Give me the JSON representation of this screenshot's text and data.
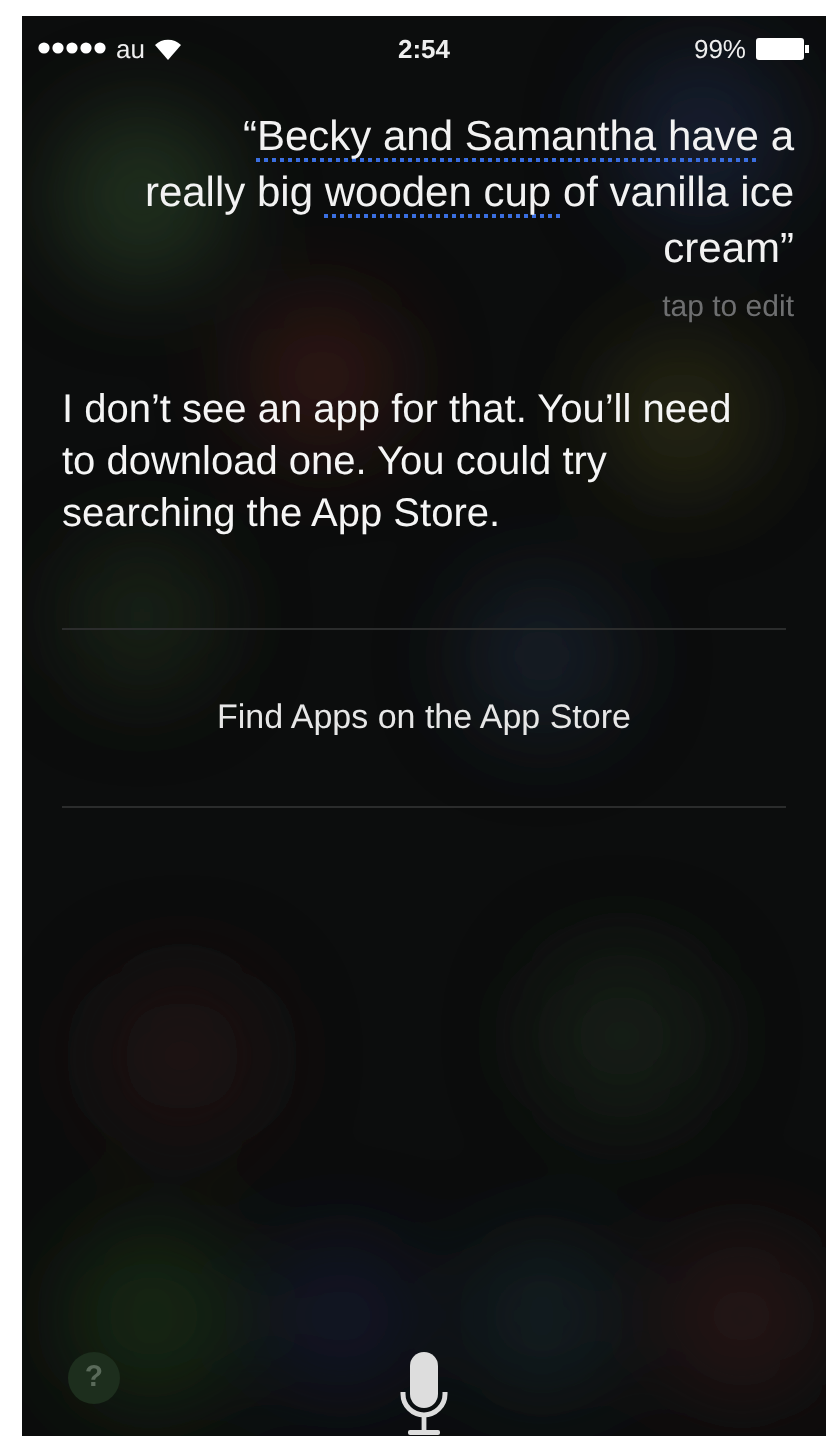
{
  "status_bar": {
    "carrier": "au",
    "time": "2:54",
    "battery": "99%"
  },
  "request": {
    "segments": [
      {
        "text": "“",
        "underlined": false
      },
      {
        "text": "Becky and Samantha have",
        "underlined": true
      },
      {
        "text": " a really big ",
        "underlined": false
      },
      {
        "text": "wooden cup ",
        "underlined": true
      },
      {
        "text": "of vanilla ice cream”",
        "underlined": false
      }
    ],
    "hint": "tap to edit"
  },
  "response": "I don’t see an app for that. You’ll need to download one. You could try searching the App Store.",
  "action": "Find Apps on the App Store",
  "help_button": "?"
}
